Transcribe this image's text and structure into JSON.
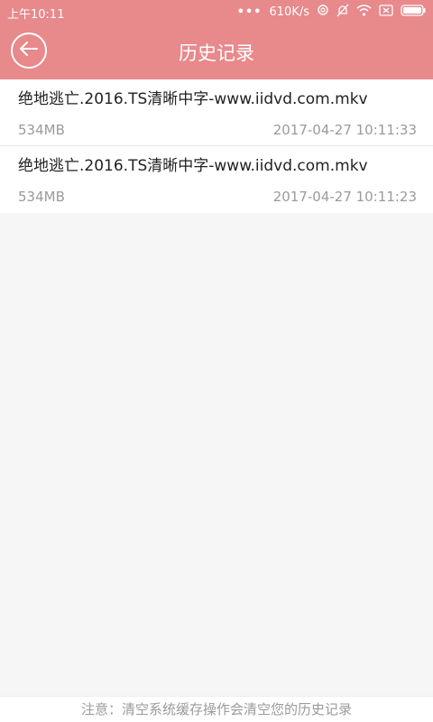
{
  "status_bar": {
    "time": "上午10:11",
    "more_icon": "more-dots-icon",
    "network_speed": "610K/s",
    "icons": [
      "sync-icon",
      "mute-bell-icon",
      "wifi-icon",
      "no-sim-icon",
      "battery-icon"
    ]
  },
  "header": {
    "back_icon": "back-arrow-icon",
    "title": "历史记录"
  },
  "history": {
    "items": [
      {
        "name": "绝地逃亡.2016.TS清晰中字-www.iidvd.com.mkv",
        "size": "534MB",
        "date": "2017-04-27 10:11:33"
      },
      {
        "name": "绝地逃亡.2016.TS清晰中字-www.iidvd.com.mkv",
        "size": "534MB",
        "date": "2017-04-27 10:11:23"
      }
    ]
  },
  "footer": {
    "note": "注意：清空系统缓存操作会清空您的历史记录"
  },
  "colors": {
    "accent": "#e8898c",
    "background": "#f6f6f6",
    "secondary_text": "#9a9a9a"
  }
}
